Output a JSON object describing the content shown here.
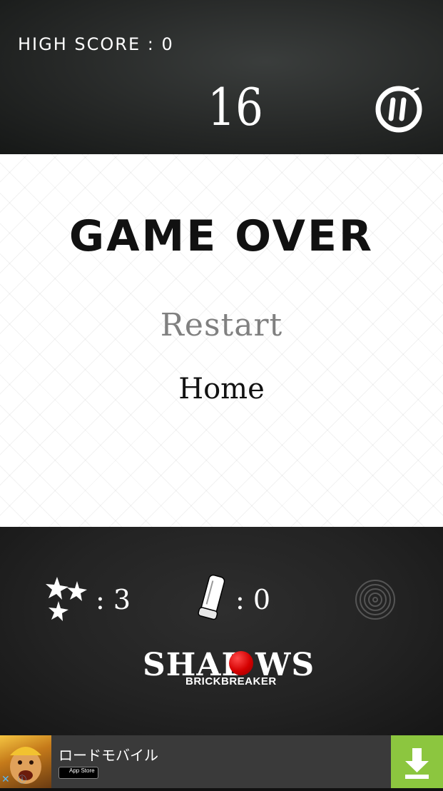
{
  "header": {
    "high_score": "HIGH SCORE : 0",
    "score": "16"
  },
  "game_over": {
    "title": "GAME OVER",
    "restart": "Restart",
    "home": "Home"
  },
  "stats": {
    "shuriken_count": ": 3",
    "bullet_count": ": 0"
  },
  "logo": {
    "part1": "SHAD",
    "part2": "WS",
    "subtitle": "BRICKBREAKER"
  },
  "ad": {
    "title": "ロードモバイル",
    "store_label": "App Store",
    "close_glyph": "✕",
    "info_glyph": "ⓘ"
  },
  "icons": {
    "pause": "pause-icon",
    "shuriken": "shuriken-icon",
    "bullet": "bullet-icon",
    "target": "target-icon",
    "download": "download-icon"
  },
  "colors": {
    "accent_red": "#d40000",
    "ad_download": "#8cc63f",
    "restart_gray": "#808080"
  }
}
